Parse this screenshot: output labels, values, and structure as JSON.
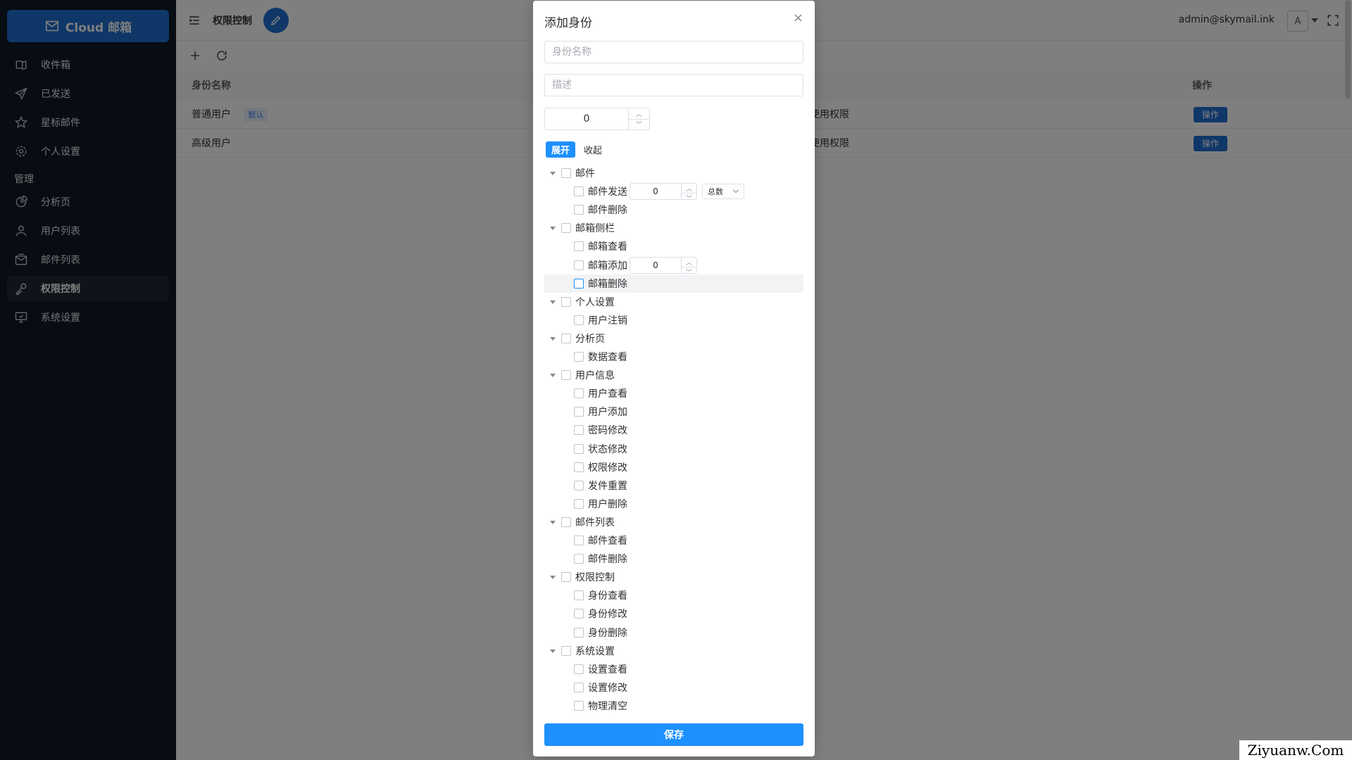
{
  "sidebar": {
    "brand": "Cloud 邮箱",
    "items": [
      {
        "label": "收件箱",
        "icon": "inbox-icon"
      },
      {
        "label": "已发送",
        "icon": "send-icon"
      },
      {
        "label": "星标邮件",
        "icon": "star-icon"
      },
      {
        "label": "个人设置",
        "icon": "gear-icon"
      }
    ],
    "section_label": "管理",
    "admin_items": [
      {
        "label": "分析页",
        "icon": "pie-chart-icon"
      },
      {
        "label": "用户列表",
        "icon": "user-icon"
      },
      {
        "label": "邮件列表",
        "icon": "mail-list-icon"
      },
      {
        "label": "权限控制",
        "icon": "key-icon"
      },
      {
        "label": "系统设置",
        "icon": "monitor-settings-icon"
      }
    ]
  },
  "header": {
    "breadcrumb": "权限控制",
    "user_email": "admin@skymail.ink",
    "avatar_letter": "A"
  },
  "table": {
    "headers": {
      "name": "身份名称",
      "operation": "操作"
    },
    "rows": [
      {
        "name": "普通用户",
        "tag": "默认",
        "perm_text": "使用权限",
        "op": "操作"
      },
      {
        "name": "高级用户",
        "tag": "",
        "perm_text": "使用权限",
        "op": "操作"
      }
    ]
  },
  "dialog": {
    "title": "添加身份",
    "close": "×",
    "name_placeholder": "身份名称",
    "desc_placeholder": "描述",
    "sort_value": "0",
    "expand_label": "展开",
    "collapse_label": "收起",
    "tree": [
      {
        "label": "邮件",
        "level": 0
      },
      {
        "label": "邮件发送",
        "level": 1,
        "number": "0",
        "select": "总数"
      },
      {
        "label": "邮件删除",
        "level": 1
      },
      {
        "label": "邮箱侧栏",
        "level": 0
      },
      {
        "label": "邮箱查看",
        "level": 1
      },
      {
        "label": "邮箱添加",
        "level": 1,
        "number": "0"
      },
      {
        "label": "邮箱删除",
        "level": 1,
        "highlight": true
      },
      {
        "label": "个人设置",
        "level": 0
      },
      {
        "label": "用户注销",
        "level": 1
      },
      {
        "label": "分析页",
        "level": 0
      },
      {
        "label": "数据查看",
        "level": 1
      },
      {
        "label": "用户信息",
        "level": 0
      },
      {
        "label": "用户查看",
        "level": 1
      },
      {
        "label": "用户添加",
        "level": 1
      },
      {
        "label": "密码修改",
        "level": 1
      },
      {
        "label": "状态修改",
        "level": 1
      },
      {
        "label": "权限修改",
        "level": 1
      },
      {
        "label": "发件重置",
        "level": 1
      },
      {
        "label": "用户删除",
        "level": 1
      },
      {
        "label": "邮件列表",
        "level": 0
      },
      {
        "label": "邮件查看",
        "level": 1
      },
      {
        "label": "邮件删除",
        "level": 1
      },
      {
        "label": "权限控制",
        "level": 0
      },
      {
        "label": "身份查看",
        "level": 1
      },
      {
        "label": "身份修改",
        "level": 1
      },
      {
        "label": "身份删除",
        "level": 1
      },
      {
        "label": "系统设置",
        "level": 0
      },
      {
        "label": "设置查看",
        "level": 1
      },
      {
        "label": "设置修改",
        "level": 1
      },
      {
        "label": "物理清空",
        "level": 1
      }
    ],
    "save_label": "保存"
  },
  "watermark": "Ziyuanw.Com"
}
